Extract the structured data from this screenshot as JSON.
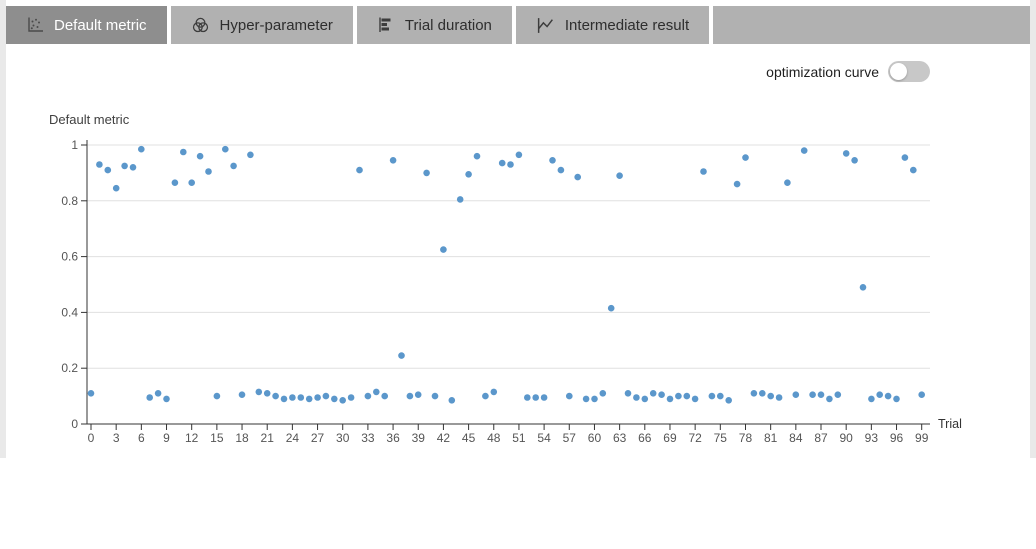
{
  "tabs": [
    {
      "label": "Default metric",
      "icon": "scatter-chart-icon",
      "active": true
    },
    {
      "label": "Hyper-parameter",
      "icon": "parallel-rings-icon",
      "active": false
    },
    {
      "label": "Trial duration",
      "icon": "bar-chart-icon",
      "active": false
    },
    {
      "label": "Intermediate result",
      "icon": "line-chart-icon",
      "active": false
    }
  ],
  "toggle": {
    "label": "optimization curve",
    "state": "off"
  },
  "colors": {
    "tabbar_bg": "#b1b1b1",
    "tab_active_bg": "#8e8e8e",
    "point": "#5b97cb",
    "axis": "#333333",
    "grid": "#e0e0e0",
    "toggle_track": "#c8c8c8"
  },
  "chart_data": {
    "type": "scatter",
    "title": "Default metric",
    "xlabel": "Trial",
    "ylabel": "Default metric",
    "xlim": [
      0,
      99
    ],
    "ylim": [
      0,
      1
    ],
    "grid": true,
    "x_ticks": [
      0,
      3,
      6,
      9,
      12,
      15,
      18,
      21,
      24,
      27,
      30,
      33,
      36,
      39,
      42,
      45,
      48,
      51,
      54,
      57,
      60,
      63,
      66,
      69,
      72,
      75,
      78,
      81,
      84,
      87,
      90,
      93,
      96,
      99
    ],
    "y_ticks": [
      0,
      0.2,
      0.4,
      0.6,
      0.8,
      1
    ],
    "x": [
      0,
      1,
      2,
      3,
      4,
      5,
      6,
      7,
      8,
      9,
      10,
      11,
      12,
      13,
      14,
      15,
      16,
      17,
      18,
      19,
      20,
      21,
      22,
      23,
      24,
      25,
      26,
      27,
      28,
      29,
      30,
      31,
      32,
      33,
      34,
      35,
      36,
      37,
      38,
      39,
      40,
      41,
      42,
      43,
      44,
      45,
      46,
      47,
      48,
      49,
      50,
      51,
      52,
      53,
      54,
      55,
      56,
      57,
      58,
      59,
      60,
      61,
      62,
      63,
      64,
      65,
      66,
      67,
      68,
      69,
      70,
      71,
      72,
      73,
      74,
      75,
      76,
      77,
      78,
      79,
      80,
      81,
      82,
      83,
      84,
      85,
      86,
      87,
      88,
      89,
      90,
      91,
      92,
      93,
      94,
      95,
      96,
      97,
      98,
      99
    ],
    "y": [
      0.11,
      0.93,
      0.91,
      0.845,
      0.925,
      0.92,
      0.985,
      0.095,
      0.11,
      0.09,
      0.865,
      0.975,
      0.865,
      0.96,
      0.905,
      0.1,
      0.985,
      0.925,
      0.105,
      0.965,
      0.115,
      0.11,
      0.1,
      0.09,
      0.095,
      0.095,
      0.09,
      0.095,
      0.1,
      0.09,
      0.085,
      0.095,
      0.91,
      0.1,
      0.115,
      0.1,
      0.945,
      0.245,
      0.1,
      0.105,
      0.9,
      0.1,
      0.625,
      0.085,
      0.805,
      0.895,
      0.96,
      0.1,
      0.115,
      0.935,
      0.93,
      0.965,
      0.095,
      0.095,
      0.095,
      0.945,
      0.91,
      0.1,
      0.885,
      0.09,
      0.09,
      0.11,
      0.415,
      0.89,
      0.11,
      0.095,
      0.09,
      0.11,
      0.105,
      0.09,
      0.1,
      0.1,
      0.09,
      0.905,
      0.1,
      0.1,
      0.085,
      0.86,
      0.955,
      0.11,
      0.11,
      0.1,
      0.095,
      0.865,
      0.105,
      0.98,
      0.105,
      0.105,
      0.09,
      0.105,
      0.97,
      0.945,
      0.49,
      0.09,
      0.105,
      0.1,
      0.09,
      0.955,
      0.91,
      0.105
    ]
  }
}
